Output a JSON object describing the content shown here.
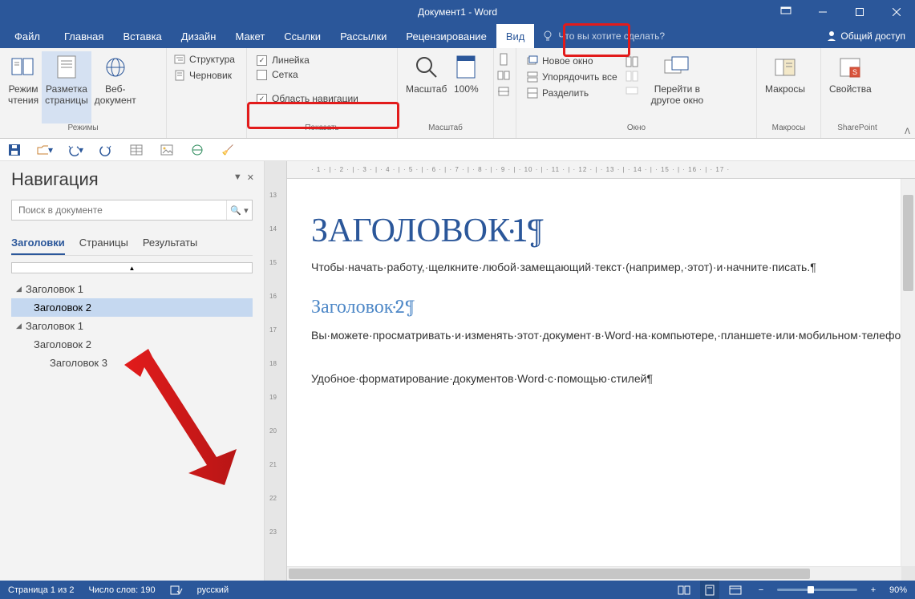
{
  "title": "Документ1 - Word",
  "menu": {
    "file": "Файл",
    "tabs": [
      "Главная",
      "Вставка",
      "Дизайн",
      "Макет",
      "Ссылки",
      "Рассылки",
      "Рецензирование",
      "Вид"
    ],
    "activeTab": "Вид",
    "tell": "Что вы хотите сделать?",
    "share": "Общий доступ"
  },
  "ribbon": {
    "groups": {
      "views": {
        "label": "Режимы",
        "reading": "Режим\nчтения",
        "pagelayout": "Разметка\nстраницы",
        "web": "Веб-\nдокумент",
        "structure": "Структура",
        "draft": "Черновик"
      },
      "show": {
        "label": "Показать",
        "ruler": "Линейка",
        "grid": "Сетка",
        "navpane": "Область навигации"
      },
      "zoom": {
        "label": "Масштаб",
        "zoom": "Масштаб",
        "hundred": "100%"
      },
      "window": {
        "label": "Окно",
        "newwin": "Новое окно",
        "arrange": "Упорядочить все",
        "split": "Разделить",
        "goto": "Перейти в\nдругое окно"
      },
      "macros": {
        "label": "Макросы",
        "btn": "Макросы"
      },
      "sharepoint": {
        "label": "SharePoint",
        "btn": "Свойства"
      }
    }
  },
  "nav": {
    "title": "Навигация",
    "search_placeholder": "Поиск в документе",
    "tabs": {
      "headings": "Заголовки",
      "pages": "Страницы",
      "results": "Результаты"
    },
    "tree": [
      {
        "label": "Заголовок 1",
        "level": 0,
        "expanded": true
      },
      {
        "label": "Заголовок 2",
        "level": 1,
        "selected": true
      },
      {
        "label": "Заголовок 1",
        "level": 0,
        "expanded": true
      },
      {
        "label": "Заголовок 2",
        "level": 1
      },
      {
        "label": "Заголовок 3",
        "level": 2
      }
    ]
  },
  "doc": {
    "h1": "ЗАГОЛОВОК·1¶",
    "p1": "Чтобы·начать·работу,·щелкните·любой·замещающий·текст·(например,·этот)·и·начните·писать.¶",
    "h2": "Заголовок·2¶",
    "p2": "Вы·можете·просматривать·и·изменять·этот·документ·в·Word·на·компьютере,·планшете·или·мобильном·телефоне.·Редактируйте·текст,·вставляйте·содержимое,·например·рисунки,·фигуры·и·таблицы,·и·сохраняйте·документ·в·облаке·с·помощью·приложения·Word·на·компьютерах·Mac,·устройствах·с·Windows,·Android·или·iOS.¶",
    "p3": "Удобное·форматирование·документов·Word·с·помощью·стилей¶"
  },
  "ruler_h": "· 1 · | · 2 · | · 3 · | · 4 · | · 5 · | · 6 · | · 7 · | · 8 · | · 9 · | · 10 · | · 11 · | · 12 · | · 13 · | · 14 · | · 15 · | · 16 · | · 17 ·",
  "ruler_v": [
    "13",
    "14",
    "15",
    "16",
    "17",
    "18",
    "19",
    "20",
    "21",
    "22",
    "23"
  ],
  "status": {
    "page": "Страница 1 из 2",
    "words": "Число слов: 190",
    "lang": "русский",
    "zoom": "90%"
  }
}
